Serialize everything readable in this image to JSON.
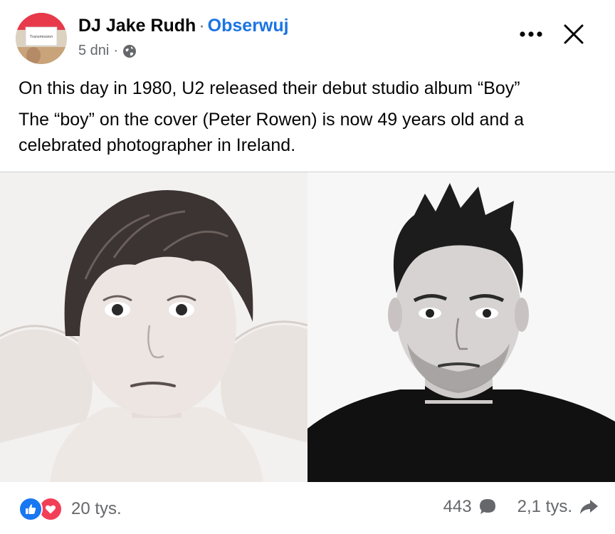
{
  "post": {
    "author": "DJ Jake Rudh",
    "separator": "·",
    "follow_label": "Obserwuj",
    "time": "5 dni",
    "time_separator": "·",
    "audience_icon": "globe-icon",
    "avatar_text": "Transmission",
    "lines": [
      "On this day in 1980, U2 released their debut studio album “Boy”",
      "The “boy” on the cover (Peter Rowen) is now 49 years old and a celebrated photographer in Ireland."
    ],
    "photos": [
      {
        "name": "album-cover-boy-photo"
      },
      {
        "name": "man-portrait-photo"
      }
    ]
  },
  "footer": {
    "reaction_count": "20 tys.",
    "comments_count": "443",
    "shares_count": "2,1 tys."
  },
  "colors": {
    "link": "#1b74e4",
    "secondary_text": "#65676b",
    "like": "#1877f2",
    "love": "#f33e58"
  }
}
